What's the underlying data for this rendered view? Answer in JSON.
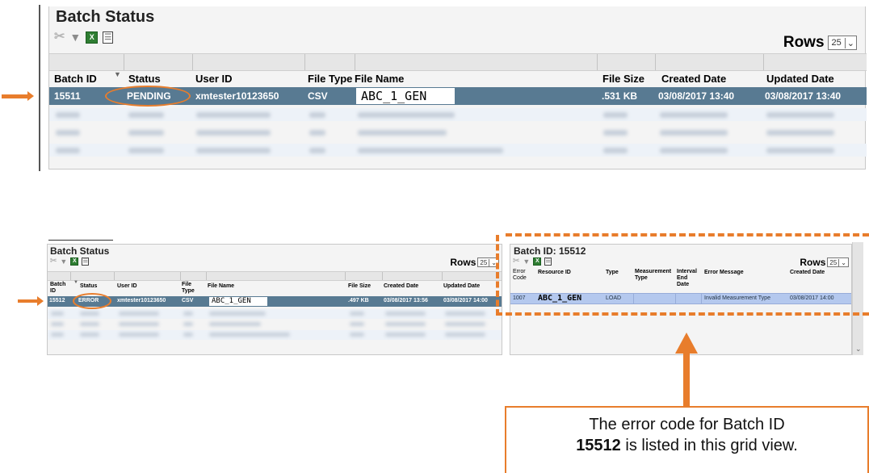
{
  "top_panel": {
    "title": "Batch Status",
    "rows_label": "Rows",
    "rows_value": "25",
    "columns": [
      "Batch ID",
      "Status",
      "User ID",
      "File Type",
      "File Name",
      "File Size",
      "Created Date",
      "Updated Date"
    ],
    "selected_row": {
      "batch_id": "15511",
      "status": "PENDING",
      "user_id": "xmtester10123650",
      "file_type": "CSV",
      "file_name": "ABC_1_GEN",
      "file_size": ".531 KB",
      "created_date": "03/08/2017 13:40",
      "updated_date": "03/08/2017 13:40"
    }
  },
  "bottom_panel": {
    "title": "Batch Status",
    "rows_label": "Rows",
    "rows_value": "25",
    "columns": {
      "batch_id_1": "Batch",
      "batch_id_2": "ID",
      "status": "Status",
      "user_id": "User ID",
      "file_type_1": "File",
      "file_type_2": "Type",
      "file_name": "File Name",
      "file_size": "File Size",
      "created_date": "Created Date",
      "updated_date": "Updated Date"
    },
    "selected_row": {
      "batch_id": "15512",
      "status": "ERROR",
      "user_id": "xmtester10123650",
      "file_type": "CSV",
      "file_name": "ABC_1_GEN",
      "file_size": ".497 KB",
      "created_date": "03/08/2017 13:56",
      "updated_date": "03/08/2017 14:00"
    }
  },
  "error_panel": {
    "title": "Batch ID: 15512",
    "rows_label": "Rows",
    "rows_value": "25",
    "columns": {
      "error_code_1": "Error",
      "error_code_2": "Code",
      "resource_id": "Resource ID",
      "type": "Type",
      "measurement_type_1": "Measurement",
      "measurement_type_2": "Type",
      "interval_end_1": "Interval",
      "interval_end_2": "End",
      "interval_end_3": "Date",
      "error_message": "Error Message",
      "created_date": "Created Date"
    },
    "row": {
      "error_code": "1007",
      "resource_id": "ABC_1_GEN",
      "type": "LOAD",
      "error_message": "Invalid Measurement Type",
      "created_date": "03/08/2017 14:00"
    }
  },
  "callout": {
    "line1": "The error code for Batch ID",
    "bold": "15512",
    "line2_rest": " is listed in this grid view."
  },
  "colors": {
    "accent_orange": "#e87d2c",
    "selected_row": "#587a92",
    "error_row": "#b4c8ee"
  },
  "icons": [
    "clear-filter-icon",
    "filter-icon",
    "excel-export-icon",
    "column-chooser-icon",
    "chevron-down-icon"
  ]
}
